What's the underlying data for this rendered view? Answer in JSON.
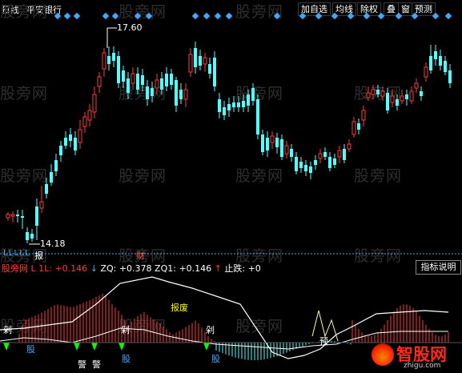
{
  "header": {
    "period": "日线",
    "stock_name": "平安银行",
    "buttons": [
      "加自选",
      "均线",
      "除权",
      "叠",
      "窗",
      "预测"
    ]
  },
  "watermark": "股旁网",
  "price_chart": {
    "high_label": "17.60",
    "low_label": "14.18",
    "marker_finance": "财",
    "marker_report": "报",
    "bottom_letters": "L L L L L"
  },
  "indicator_bar": {
    "name": "股旁网",
    "l_label": "L 1L:",
    "l_value": "+0.146",
    "arrow": "↓",
    "zq_label": "ZQ:",
    "zq_value": "+0.378",
    "zq1_label": "ZQ1:",
    "zq1_value": "+0.146",
    "stop_arrow": "↑",
    "stop_label": "止跌:",
    "stop_value": "+0",
    "help_button": "指标说明"
  },
  "indicator_chart": {
    "signals": {
      "jian": "剁",
      "gu": "股",
      "jing": "警",
      "yu": "预",
      "alarm": "报废"
    }
  },
  "logo": {
    "text": "智股网",
    "url": "zhigu.com"
  },
  "colors": {
    "bg": "#000000",
    "up": "#ff3a3a",
    "down": "#54ffff",
    "accent": "#3fa9ff",
    "yellow": "#ffff00",
    "green": "#00ff00"
  }
}
